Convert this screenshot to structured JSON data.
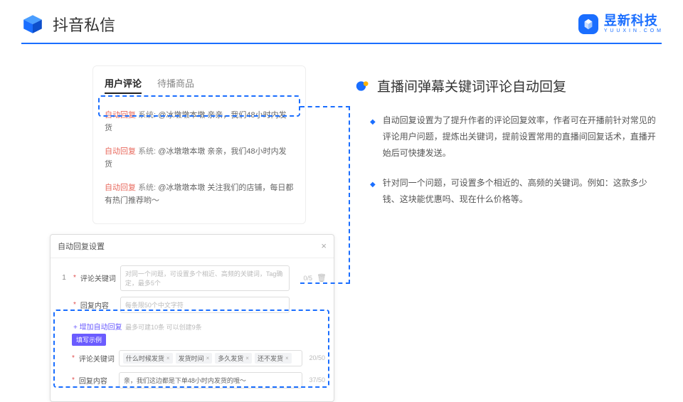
{
  "header": {
    "title": "抖音私信",
    "brand_name": "昱新科技",
    "brand_sub": "Y U U X I N . C O M"
  },
  "panel": {
    "tab_a": "用户评论",
    "tab_b": "待播商品",
    "comments": {
      "tag": "自动回复",
      "sys": "系统:",
      "c1": "@冰墩墩本墩 亲亲，我们48小时内发货",
      "c2": "@冰墩墩本墩 亲亲，我们48小时内发货",
      "c3": "@冰墩墩本墩 关注我们的店铺，每日都有热门推荐哟～"
    }
  },
  "settings": {
    "title": "自动回复设置",
    "row1_num": "1",
    "label_keyword": "评论关键词",
    "placeholder_keyword": "对同一个问题，可设置多个相近、高频的关键词，Tag确定，最多5个",
    "count1": "0/5",
    "label_content": "回复内容",
    "placeholder_content": "每条限50个中文字符",
    "add_link": "增加自动回复",
    "add_hint": "最多可建10条 可以创建9条",
    "example_badge": "填写示例",
    "chips": {
      "a": "什么时候发货",
      "b": "发货时间",
      "c": "多久发货",
      "d": "还不发货"
    },
    "chip_count": "20/50",
    "example_content": "亲，我们这边都是下单48小时内发货的哦～",
    "example_count": "37/50"
  },
  "right": {
    "title": "直播间弹幕关键词评论自动回复",
    "p1": "自动回复设置为了提升作者的评论回复效率，作者可在开播前针对常见的评论用户问题，提炼出关键词，提前设置常用的直播间回复话术，直播开始后可快捷发送。",
    "p2": "针对同一个问题，可设置多个相近的、高频的关键词。例如：这款多少钱、这块能优惠吗、现在什么价格等。"
  }
}
